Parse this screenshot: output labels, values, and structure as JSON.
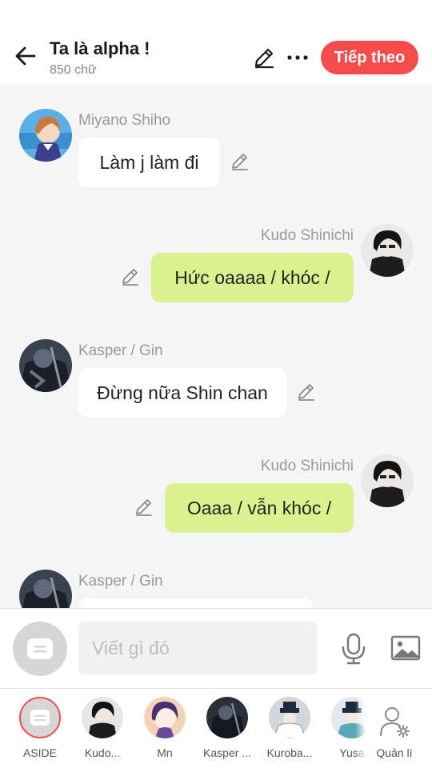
{
  "header": {
    "title": "Ta là alpha !",
    "word_count": "850 chữ",
    "next_label": "Tiếp theo"
  },
  "messages": [
    {
      "side": "left",
      "name": "Miyano Shiho",
      "text": "Làm j làm đi",
      "avatar": "avatar-miyano"
    },
    {
      "side": "right",
      "name": "Kudo Shinichi",
      "text": "Hức oaaaa / khóc /",
      "avatar": "avatar-kudo"
    },
    {
      "side": "left",
      "name": "Kasper / Gin",
      "text": "Đừng nữa Shin chan",
      "avatar": "avatar-kasper"
    },
    {
      "side": "right",
      "name": "Kudo Shinichi",
      "text": "Oaaa / vẫn khóc /",
      "avatar": "avatar-kudo"
    },
    {
      "side": "left",
      "name": "Kasper / Gin",
      "text": "",
      "avatar": "avatar-kasper"
    }
  ],
  "composer": {
    "placeholder": "Viết gì đó",
    "icons": [
      "aside-icon",
      "mic-icon",
      "image-icon"
    ]
  },
  "characters": [
    {
      "label": "ASIDE",
      "selected": true
    },
    {
      "label": "Kudo..."
    },
    {
      "label": "Mn"
    },
    {
      "label": "Kasper ..."
    },
    {
      "label": "Kuroba..."
    },
    {
      "label": "Yusa"
    }
  ],
  "manage_label": "Quản lí",
  "colors": {
    "accent": "#f44b4b",
    "bubble_right": "#d9f28f",
    "bubble_left": "#ffffff",
    "background": "#f5f5f5"
  }
}
